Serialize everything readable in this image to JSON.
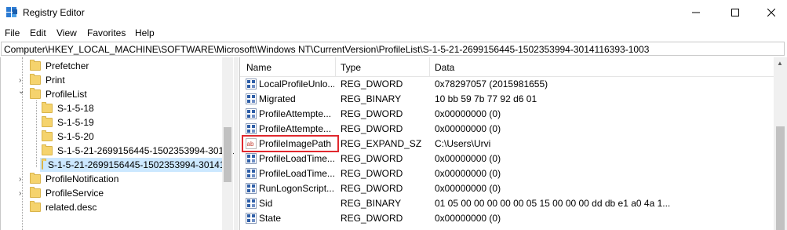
{
  "window": {
    "title": "Registry Editor",
    "minimize_label": "—",
    "maximize_label": "☐",
    "close_label": "✕"
  },
  "menu": [
    "File",
    "Edit",
    "View",
    "Favorites",
    "Help"
  ],
  "address": "Computer\\HKEY_LOCAL_MACHINE\\SOFTWARE\\Microsoft\\Windows NT\\CurrentVersion\\ProfileList\\S-1-5-21-2699156445-1502353994-3014116393-1003",
  "tree": [
    {
      "label": "Prefetcher",
      "expander": ""
    },
    {
      "label": "Print",
      "expander": "›"
    },
    {
      "label": "ProfileList",
      "expander": "⌄"
    },
    {
      "label": "S-1-5-18",
      "expander": ""
    },
    {
      "label": "S-1-5-19",
      "expander": ""
    },
    {
      "label": "S-1-5-20",
      "expander": ""
    },
    {
      "label": "S-1-5-21-2699156445-1502353994-30141",
      "expander": ""
    },
    {
      "label": "S-1-5-21-2699156445-1502353994-30141",
      "expander": ""
    },
    {
      "label": "ProfileNotification",
      "expander": "›"
    },
    {
      "label": "ProfileService",
      "expander": "›"
    },
    {
      "label": "related.desc",
      "expander": ""
    }
  ],
  "columns": {
    "name": "Name",
    "type": "Type",
    "data": "Data"
  },
  "values": [
    {
      "name": "LocalProfileUnlo...",
      "type": "REG_DWORD",
      "data": "0x78297057 (2015981655)",
      "icon": "binary-value-icon"
    },
    {
      "name": "Migrated",
      "type": "REG_BINARY",
      "data": "10 bb 59 7b 77 92 d6 01",
      "icon": "binary-value-icon"
    },
    {
      "name": "ProfileAttempte...",
      "type": "REG_DWORD",
      "data": "0x00000000 (0)",
      "icon": "binary-value-icon"
    },
    {
      "name": "ProfileAttempte...",
      "type": "REG_DWORD",
      "data": "0x00000000 (0)",
      "icon": "binary-value-icon"
    },
    {
      "name": "ProfileImagePath",
      "type": "REG_EXPAND_SZ",
      "data": "C:\\Users\\Urvi",
      "icon": "string-value-icon"
    },
    {
      "name": "ProfileLoadTime...",
      "type": "REG_DWORD",
      "data": "0x00000000 (0)",
      "icon": "binary-value-icon"
    },
    {
      "name": "ProfileLoadTime...",
      "type": "REG_DWORD",
      "data": "0x00000000 (0)",
      "icon": "binary-value-icon"
    },
    {
      "name": "RunLogonScript...",
      "type": "REG_DWORD",
      "data": "0x00000000 (0)",
      "icon": "binary-value-icon"
    },
    {
      "name": "Sid",
      "type": "REG_BINARY",
      "data": "01 05 00 00 00 00 00 05 15 00 00 00 dd db e1 a0 4a 1...",
      "icon": "binary-value-icon"
    },
    {
      "name": "State",
      "type": "REG_DWORD",
      "data": "0x00000000 (0)",
      "icon": "binary-value-icon"
    }
  ],
  "colors": {
    "highlight_border": "#e0282e",
    "selection": "#cce8ff"
  }
}
